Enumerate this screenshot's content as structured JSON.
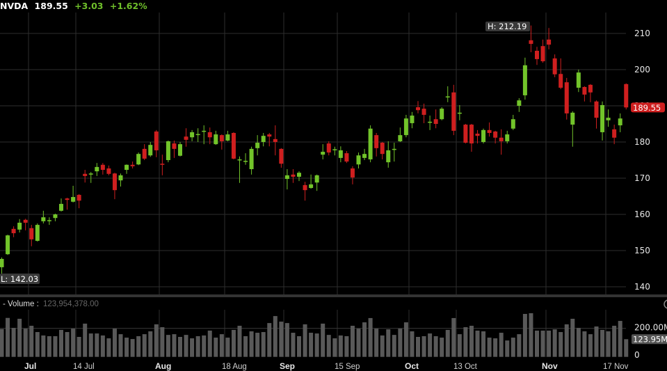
{
  "header": {
    "symbol": "NVDA",
    "last": "189.55",
    "change": "+3.03",
    "change_pct": "+1.62%"
  },
  "colors": {
    "up": "#72c42a",
    "down": "#cf1f1f",
    "volume": "#595959",
    "grid": "#2e2e2e",
    "last_price_tag": "#cf1f1f"
  },
  "chart_data": [
    {
      "type": "candlestick",
      "title": "NVDA",
      "y_axis_ticks": [
        "140",
        "150",
        "160",
        "170",
        "180",
        "190",
        "200",
        "210"
      ],
      "ylim": [
        138,
        215
      ],
      "x_tick_labels": [
        {
          "label": "Jul",
          "bold": true,
          "index": 4
        },
        {
          "label": "14 Jul",
          "bold": false,
          "index": 12
        },
        {
          "label": "Aug",
          "bold": true,
          "index": 26
        },
        {
          "label": "18 Aug",
          "bold": false,
          "index": 37
        },
        {
          "label": "Sep",
          "bold": true,
          "index": 47
        },
        {
          "label": "15 Sep",
          "bold": false,
          "index": 56
        },
        {
          "label": "Oct",
          "bold": true,
          "index": 68
        },
        {
          "label": "13 Oct",
          "bold": false,
          "index": 76
        },
        {
          "label": "Nov",
          "bold": true,
          "index": 91
        },
        {
          "label": "17 Nov",
          "bold": false,
          "index": 101
        }
      ],
      "high_label": "H: 212.19",
      "low_label": "L: 142.03",
      "last_price_label": "189.55",
      "ohlc": [
        [
          145.4,
          148.1,
          142.03,
          147.7
        ],
        [
          149.0,
          154.4,
          148.8,
          154.2
        ],
        [
          156.0,
          156.7,
          153.7,
          154.8
        ],
        [
          155.8,
          158.7,
          155.0,
          157.7
        ],
        [
          158.5,
          158.8,
          155.6,
          157.7
        ],
        [
          156.2,
          157.1,
          151.2,
          153.1
        ],
        [
          152.7,
          157.5,
          152.5,
          157.1
        ],
        [
          158.1,
          161.0,
          157.5,
          159.2
        ],
        [
          158.2,
          159.2,
          157.1,
          158.4
        ],
        [
          159.0,
          160.2,
          158.1,
          160.0
        ],
        [
          161.0,
          164.4,
          160.8,
          162.9
        ],
        [
          164.4,
          164.6,
          161.3,
          164.0
        ],
        [
          163.5,
          167.9,
          163.3,
          164.8
        ],
        [
          165.4,
          165.6,
          161.7,
          163.8
        ],
        [
          171.2,
          172.3,
          168.8,
          170.6
        ],
        [
          171.0,
          171.7,
          168.7,
          171.3
        ],
        [
          171.9,
          174.2,
          170.6,
          173.1
        ],
        [
          173.7,
          174.2,
          171.0,
          172.3
        ],
        [
          172.7,
          173.5,
          170.8,
          171.2
        ],
        [
          171.3,
          171.5,
          164.2,
          166.7
        ],
        [
          169.4,
          171.3,
          167.7,
          170.8
        ],
        [
          172.3,
          173.8,
          171.2,
          173.7
        ],
        [
          173.7,
          174.6,
          172.7,
          173.3
        ],
        [
          173.8,
          177.1,
          173.6,
          176.7
        ],
        [
          178.1,
          179.4,
          175.0,
          175.4
        ],
        [
          176.3,
          180.0,
          175.9,
          179.2
        ],
        [
          182.9,
          183.3,
          175.8,
          177.7
        ],
        [
          174.0,
          176.5,
          170.8,
          173.7
        ],
        [
          175.0,
          180.4,
          174.4,
          180.2
        ],
        [
          179.6,
          180.4,
          175.6,
          178.1
        ],
        [
          176.2,
          180.0,
          176.0,
          179.4
        ],
        [
          181.5,
          183.8,
          178.7,
          180.6
        ],
        [
          181.3,
          183.3,
          180.2,
          182.7
        ],
        [
          182.0,
          183.8,
          180.0,
          182.2
        ],
        [
          182.9,
          184.6,
          179.4,
          183.1
        ],
        [
          182.7,
          184.0,
          179.4,
          181.3
        ],
        [
          179.4,
          183.1,
          179.2,
          182.1
        ],
        [
          181.9,
          182.1,
          177.9,
          180.2
        ],
        [
          180.4,
          183.1,
          180.2,
          182.1
        ],
        [
          182.5,
          182.7,
          175.2,
          175.4
        ],
        [
          175.0,
          176.0,
          168.7,
          175.2
        ],
        [
          174.7,
          176.9,
          173.7,
          174.8
        ],
        [
          172.5,
          178.7,
          171.0,
          178.1
        ],
        [
          178.3,
          181.9,
          176.3,
          179.8
        ],
        [
          180.0,
          182.5,
          178.8,
          181.7
        ],
        [
          182.1,
          182.5,
          178.8,
          181.5
        ],
        [
          180.8,
          184.6,
          176.3,
          180.0
        ],
        [
          178.1,
          178.3,
          172.9,
          174.0
        ],
        [
          169.8,
          172.5,
          166.9,
          170.8
        ],
        [
          171.0,
          172.5,
          168.7,
          170.4
        ],
        [
          170.4,
          171.9,
          169.2,
          171.5
        ],
        [
          168.1,
          169.0,
          163.8,
          166.7
        ],
        [
          167.3,
          171.0,
          167.1,
          168.3
        ],
        [
          168.8,
          171.0,
          166.5,
          170.8
        ],
        [
          176.5,
          179.4,
          175.2,
          177.3
        ],
        [
          179.6,
          180.2,
          176.3,
          177.1
        ],
        [
          177.8,
          178.7,
          176.3,
          178.0
        ],
        [
          175.6,
          178.8,
          174.4,
          177.7
        ],
        [
          176.9,
          177.5,
          174.2,
          174.6
        ],
        [
          172.7,
          173.3,
          168.3,
          170.2
        ],
        [
          173.8,
          177.1,
          172.7,
          176.3
        ],
        [
          175.6,
          178.1,
          175.0,
          176.7
        ],
        [
          175.2,
          184.6,
          174.4,
          183.7
        ],
        [
          181.9,
          182.5,
          176.0,
          178.3
        ],
        [
          179.8,
          180.0,
          175.2,
          176.7
        ],
        [
          174.4,
          180.2,
          172.9,
          177.7
        ],
        [
          178.0,
          179.8,
          174.6,
          178.1
        ],
        [
          180.2,
          184.0,
          180.0,
          181.9
        ],
        [
          181.9,
          187.5,
          181.3,
          186.5
        ],
        [
          185.2,
          188.3,
          183.8,
          187.3
        ],
        [
          189.6,
          191.3,
          187.9,
          188.8
        ],
        [
          189.2,
          190.6,
          185.2,
          187.5
        ],
        [
          185.5,
          187.3,
          183.3,
          185.6
        ],
        [
          186.3,
          189.0,
          183.8,
          185.0
        ],
        [
          186.3,
          189.6,
          186.0,
          189.2
        ],
        [
          192.4,
          195.4,
          191.0,
          192.6
        ],
        [
          193.7,
          195.8,
          181.9,
          183.1
        ],
        [
          188.0,
          190.2,
          186.0,
          188.1
        ],
        [
          184.8,
          185.0,
          179.6,
          179.8
        ],
        [
          184.8,
          185.0,
          177.3,
          179.6
        ],
        [
          182.3,
          183.3,
          179.6,
          181.7
        ],
        [
          180.0,
          183.7,
          179.6,
          183.3
        ],
        [
          183.3,
          185.4,
          181.5,
          182.5
        ],
        [
          182.9,
          183.1,
          179.6,
          181.2
        ],
        [
          181.2,
          183.5,
          176.5,
          180.2
        ],
        [
          180.2,
          183.1,
          179.6,
          182.1
        ],
        [
          183.7,
          187.5,
          183.3,
          186.3
        ],
        [
          190.0,
          192.1,
          188.3,
          191.5
        ],
        [
          192.9,
          203.3,
          191.7,
          201.2
        ],
        [
          208.1,
          212.19,
          204.8,
          207.1
        ],
        [
          205.2,
          206.3,
          201.3,
          202.9
        ],
        [
          206.5,
          208.3,
          201.9,
          202.3
        ],
        [
          208.3,
          211.5,
          205.6,
          206.9
        ],
        [
          203.1,
          204.2,
          197.9,
          198.7
        ],
        [
          198.8,
          203.1,
          194.6,
          195.0
        ],
        [
          196.5,
          197.7,
          186.2,
          187.9
        ],
        [
          184.8,
          188.5,
          178.7,
          188.1
        ],
        [
          195.0,
          200.0,
          193.8,
          199.2
        ],
        [
          195.2,
          195.4,
          191.2,
          193.1
        ],
        [
          195.8,
          196.0,
          191.0,
          193.7
        ],
        [
          191.2,
          191.5,
          183.7,
          186.7
        ],
        [
          182.7,
          191.2,
          180.4,
          190.2
        ],
        [
          186.0,
          189.0,
          184.2,
          186.7
        ],
        [
          183.5,
          184.8,
          179.4,
          181.2
        ],
        [
          184.6,
          187.9,
          182.7,
          186.5
        ],
        [
          196.0,
          196.2,
          189.0,
          189.55
        ]
      ],
      "volume": {
        "label": "- Volume :",
        "last_value": "123,954,378.00",
        "unit": "M",
        "y_axis_ticks": [
          "0",
          "200.00M"
        ],
        "last_tag": "123.95M",
        "ylim": [
          0,
          310
        ],
        "values": [
          195,
          273,
          203,
          267,
          198,
          218,
          174,
          150,
          145,
          145,
          189,
          174,
          198,
          140,
          233,
          164,
          164,
          150,
          130,
          198,
          159,
          135,
          125,
          145,
          159,
          179,
          228,
          208,
          154,
          159,
          140,
          154,
          130,
          145,
          150,
          184,
          135,
          159,
          135,
          189,
          218,
          145,
          179,
          169,
          174,
          237,
          286,
          247,
          237,
          169,
          145,
          228,
          169,
          164,
          233,
          154,
          130,
          150,
          145,
          218,
          198,
          242,
          272,
          198,
          150,
          193,
          154,
          198,
          242,
          179,
          140,
          145,
          164,
          145,
          135,
          189,
          272,
          159,
          208,
          218,
          184,
          179,
          135,
          130,
          169,
          115,
          135,
          159,
          301,
          306,
          184,
          184,
          184,
          193,
          174,
          228,
          267,
          203,
          179,
          159,
          213,
          189,
          179,
          218,
          252,
          123.95
        ]
      }
    }
  ]
}
